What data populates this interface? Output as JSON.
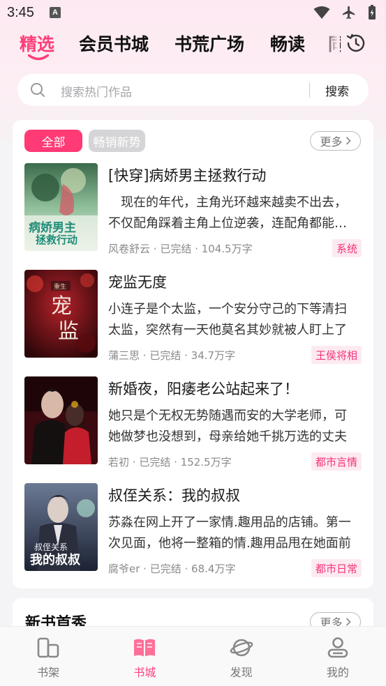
{
  "status_bar": {
    "time": "3:45",
    "notification_letter": "A"
  },
  "tabs": [
    {
      "label": "精选",
      "active": true
    },
    {
      "label": "会员书城",
      "active": false
    },
    {
      "label": "书荒广场",
      "active": false
    },
    {
      "label": "畅读",
      "active": false
    },
    {
      "label": "同",
      "active": false
    }
  ],
  "search": {
    "placeholder": "搜索热门作品",
    "button_label": "搜索"
  },
  "section": {
    "chips": [
      "全部",
      "畅销新势"
    ],
    "more_label": "更多",
    "books": [
      {
        "title": "[快穿]病娇男主拯救行动",
        "description": "　现在的年代，主角光环越来越卖不出去，不仅配角踩着主角上位逆袭，连配角都能上位",
        "author": "风卷舒云",
        "status": "已完结",
        "words": "104.5万字",
        "tag": "系统",
        "cover_text": "病娇男主拯救行动"
      },
      {
        "title": "宠监无度",
        "description": "小连子是个太监，一个安分守己的下等清扫太监，突然有一天他莫名其妙就被人盯上了",
        "author": "蒲三思",
        "status": "已完结",
        "words": "34.7万字",
        "tag": "王侯将相",
        "cover_text": "宠监"
      },
      {
        "title": "新婚夜，阳痿老公站起来了！",
        "description": "她只是个无权无势随遇而安的大学老师，可她做梦也没想到，母亲给她千挑万选的丈夫",
        "author": "若初",
        "status": "已完结",
        "words": "152.5万字",
        "tag": "都市言情",
        "cover_text": ""
      },
      {
        "title": "叔侄关系：我的叔叔",
        "description": "苏淼在网上开了一家情.趣用品的店铺。第一次见面，他将一整箱的情.趣用品甩在她面前",
        "author": "腐爷er",
        "status": "已完结",
        "words": "68.4万字",
        "tag": "都市日常",
        "cover_text": "叔侄关系 我的叔叔"
      }
    ]
  },
  "section2": {
    "title": "新书首秀",
    "more_label": "更多"
  },
  "bottom_nav": [
    {
      "label": "书架",
      "icon": "bookshelf-icon",
      "active": false
    },
    {
      "label": "书城",
      "icon": "open-book-icon",
      "active": true
    },
    {
      "label": "发现",
      "icon": "planet-icon",
      "active": false
    },
    {
      "label": "我的",
      "icon": "user-icon",
      "active": false
    }
  ],
  "colors": {
    "accent": "#ff3f7a",
    "tag_bg": "#fdeaf1",
    "chip_inactive": "#d5d5d7"
  }
}
